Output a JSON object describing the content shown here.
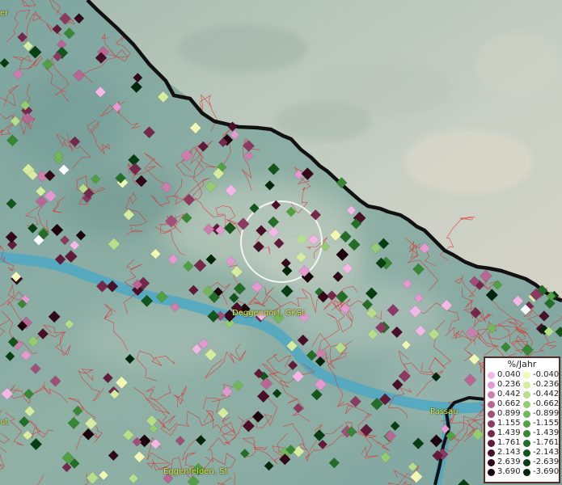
{
  "map": {
    "places": [
      {
        "id": "deggendorf",
        "label": "Deggendorf, GKSt"
      },
      {
        "id": "passau",
        "label": "Passau"
      },
      {
        "id": "eggenfelden",
        "label": "Eggenfelden, St"
      },
      {
        "id": "top_left",
        "label": "er"
      },
      {
        "id": "left_edge",
        "label": "ut"
      }
    ]
  },
  "legend": {
    "title": "%/Jahr",
    "positive": [
      {
        "label": "0.040",
        "color": "#f4b8e6"
      },
      {
        "label": "0.236",
        "color": "#e49ad0"
      },
      {
        "label": "0.442",
        "color": "#cc7fae"
      },
      {
        "label": "0.662",
        "color": "#b86693"
      },
      {
        "label": "0.899",
        "color": "#a04f78"
      },
      {
        "label": "1.155",
        "color": "#8c3a62"
      },
      {
        "label": "1.439",
        "color": "#76284c"
      },
      {
        "label": "1.761",
        "color": "#611a39"
      },
      {
        "label": "2.143",
        "color": "#4a0f28"
      },
      {
        "label": "2.639",
        "color": "#330819"
      },
      {
        "label": "3.690",
        "color": "#1c030c"
      }
    ],
    "negative": [
      {
        "label": "-0.040",
        "color": "#f1f7b5"
      },
      {
        "label": "-0.236",
        "color": "#d6eda0"
      },
      {
        "label": "-0.442",
        "color": "#b7de8a"
      },
      {
        "label": "-0.662",
        "color": "#95cc72"
      },
      {
        "label": "-0.899",
        "color": "#72b85a"
      },
      {
        "label": "-1.155",
        "color": "#52a044"
      },
      {
        "label": "-1.439",
        "color": "#378733"
      },
      {
        "label": "-1.761",
        "color": "#226e26"
      },
      {
        "label": "-2.143",
        "color": "#12561b"
      },
      {
        "label": "-2.639",
        "color": "#073f12"
      },
      {
        "label": "-3.690",
        "color": "#02260a"
      }
    ]
  }
}
